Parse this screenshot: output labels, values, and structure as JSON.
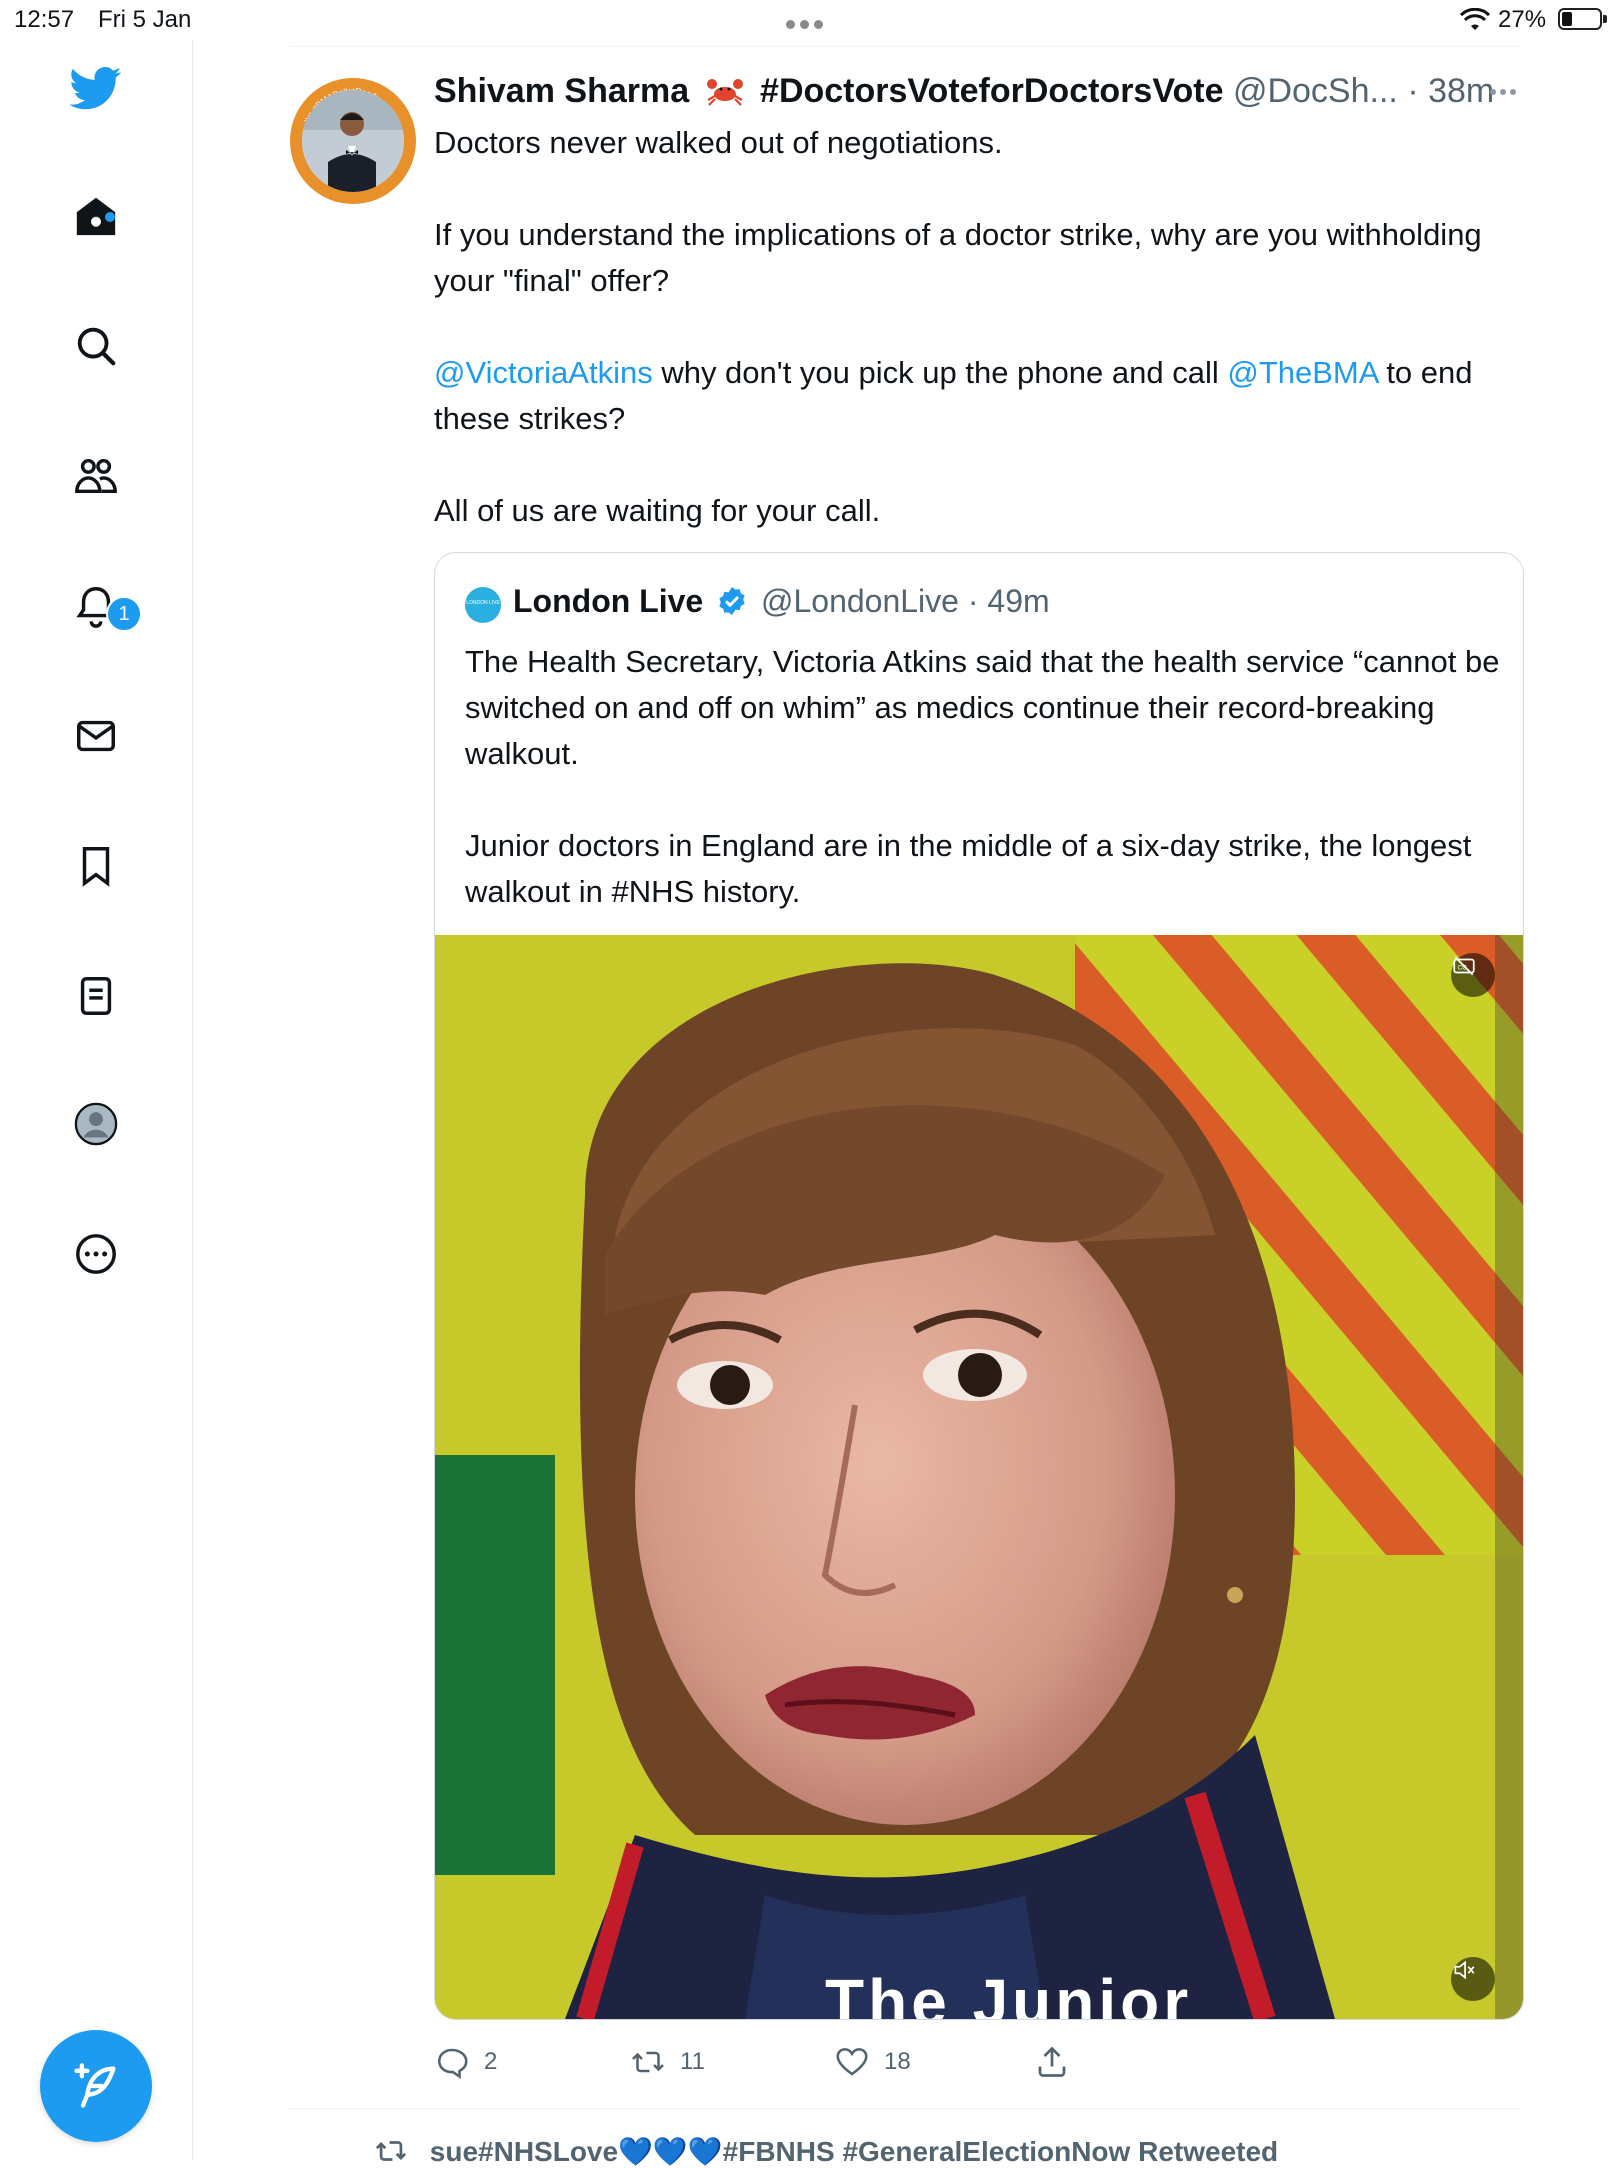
{
  "status_bar": {
    "time": "12:57",
    "date": "Fri 5 Jan",
    "battery": "27%",
    "battery_level": 0.27
  },
  "sidebar": {
    "items": [
      {
        "name": "home",
        "icon": "house-icon"
      },
      {
        "name": "explore",
        "icon": "search-icon"
      },
      {
        "name": "communities",
        "icon": "people-icon"
      },
      {
        "name": "notifications",
        "icon": "bell-icon",
        "badge": "1"
      },
      {
        "name": "messages",
        "icon": "envelope-icon"
      },
      {
        "name": "bookmarks",
        "icon": "bookmark-icon"
      },
      {
        "name": "lists",
        "icon": "list-icon"
      },
      {
        "name": "profile",
        "icon": "avatar-icon"
      },
      {
        "name": "more",
        "icon": "ellipsis-circle-icon"
      }
    ],
    "brand_color": "#1d9bf0"
  },
  "tweet": {
    "author_name": "Shivam Sharma",
    "author_emoji": "crab-icon",
    "author_tag": "#DoctorsVoteforDoctorsVote",
    "handle": "@DocSh...",
    "time": "38m",
    "avatar_ring_text_top": "I'm #BMABallotReady",
    "avatar_ring_text_bottom": "Vote Yes for strike action",
    "text": {
      "p1": "Doctors never walked out of negotiations.",
      "p2": "If you understand the implications of a doctor strike, why are you withholding your \"final\" offer?",
      "p3_mention1": "@VictoriaAtkins",
      "p3_mid": " why don't you pick up the phone and call ",
      "p3_mention2": "@TheBMA",
      "p3_end": " to end these strikes?",
      "p4": "All of us are waiting for your call."
    },
    "quote": {
      "name": "London Live",
      "handle": "@LondonLive",
      "time": "49m",
      "avatar_text": "LONDON LIVE",
      "text_p1": "The Health Secretary, Victoria Atkins said that the health service “cannot be switched on and off on whim”  as medics continue their record-breaking walkout.",
      "text_p2": "Junior doctors in England are in the middle of a six-day strike, the longest walkout in #NHS history.",
      "video_caption": "The Junior"
    },
    "actions": {
      "replies": "2",
      "retweets": "11",
      "likes": "18"
    }
  },
  "next_item": {
    "retweet_line": "sue#NHSLove💙💙💙#FBNHS #GeneralElectionNow Retweeted"
  }
}
